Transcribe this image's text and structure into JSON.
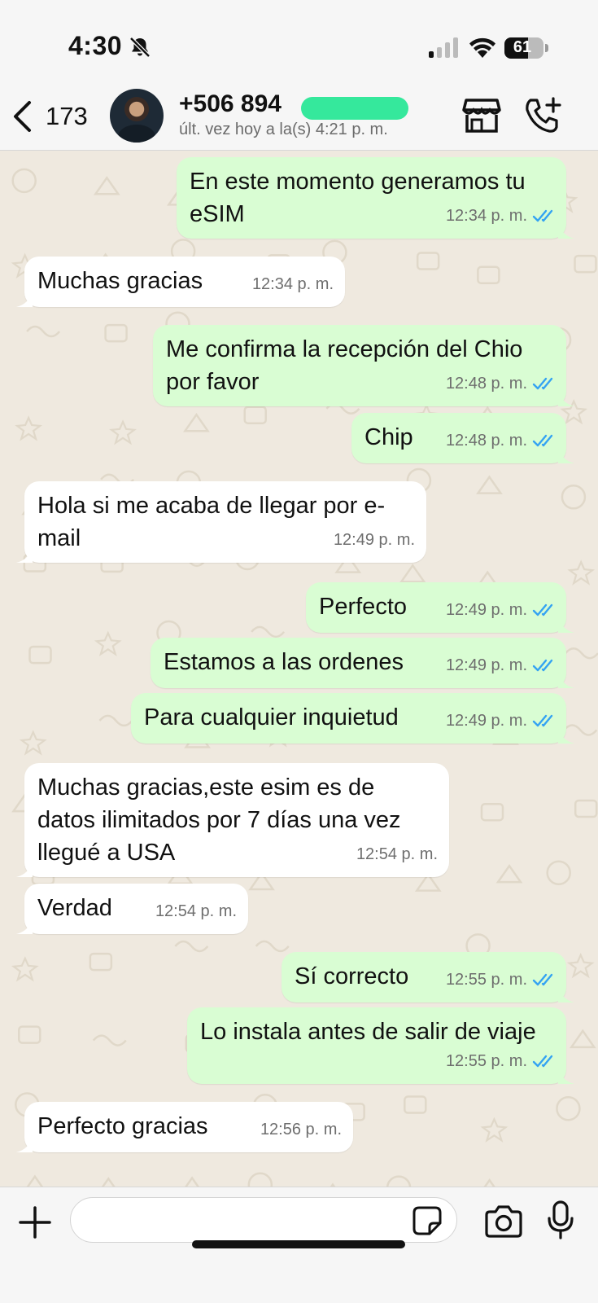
{
  "status_bar": {
    "time": "4:30",
    "battery_percent": "61",
    "battery_level": 0.61
  },
  "header": {
    "back_count": "173",
    "contact_name": "+506 894",
    "last_seen": "últ. vez hoy a la(s) 4:21 p. m."
  },
  "messages": [
    {
      "direction": "out",
      "text": "En este momento generamos tu\neSIM",
      "time": "12:34 p. m.",
      "read": true
    },
    {
      "direction": "in",
      "text": "Muchas gracias",
      "time": "12:34 p. m."
    },
    {
      "direction": "out",
      "text": "Me confirma la recepción del Chio\npor favor",
      "time": "12:48 p. m.",
      "read": true
    },
    {
      "direction": "out",
      "text": "Chip",
      "time": "12:48 p. m.",
      "read": true
    },
    {
      "direction": "in",
      "text": "Hola si me acaba de llegar por e-\nmail",
      "time": "12:49 p. m."
    },
    {
      "direction": "out",
      "text": "Perfecto",
      "time": "12:49 p. m.",
      "read": true
    },
    {
      "direction": "out",
      "text": "Estamos a las ordenes",
      "time": "12:49 p. m.",
      "read": true
    },
    {
      "direction": "out",
      "text": "Para cualquier inquietud",
      "time": "12:49 p. m.",
      "read": true
    },
    {
      "direction": "in",
      "text": "Muchas gracias,este esim es de\ndatos ilimitados por 7 días una vez\nllegué a USA",
      "time": "12:54 p. m."
    },
    {
      "direction": "in",
      "text": "Verdad",
      "time": "12:54 p. m."
    },
    {
      "direction": "out",
      "text": "Sí correcto",
      "time": "12:55 p. m.",
      "read": true
    },
    {
      "direction": "out",
      "text": "Lo instala antes de salir de viaje",
      "time": "12:55 p. m.",
      "read": true
    },
    {
      "direction": "in",
      "text": "Perfecto gracias",
      "time": "12:56 p. m."
    }
  ],
  "input": {
    "value": "",
    "placeholder": ""
  },
  "colors": {
    "outgoing_bubble": "#d9fdd3",
    "incoming_bubble": "#ffffff",
    "chat_background": "#efe9df",
    "read_ticks": "#34a3f2",
    "redaction": "#35e89c"
  }
}
